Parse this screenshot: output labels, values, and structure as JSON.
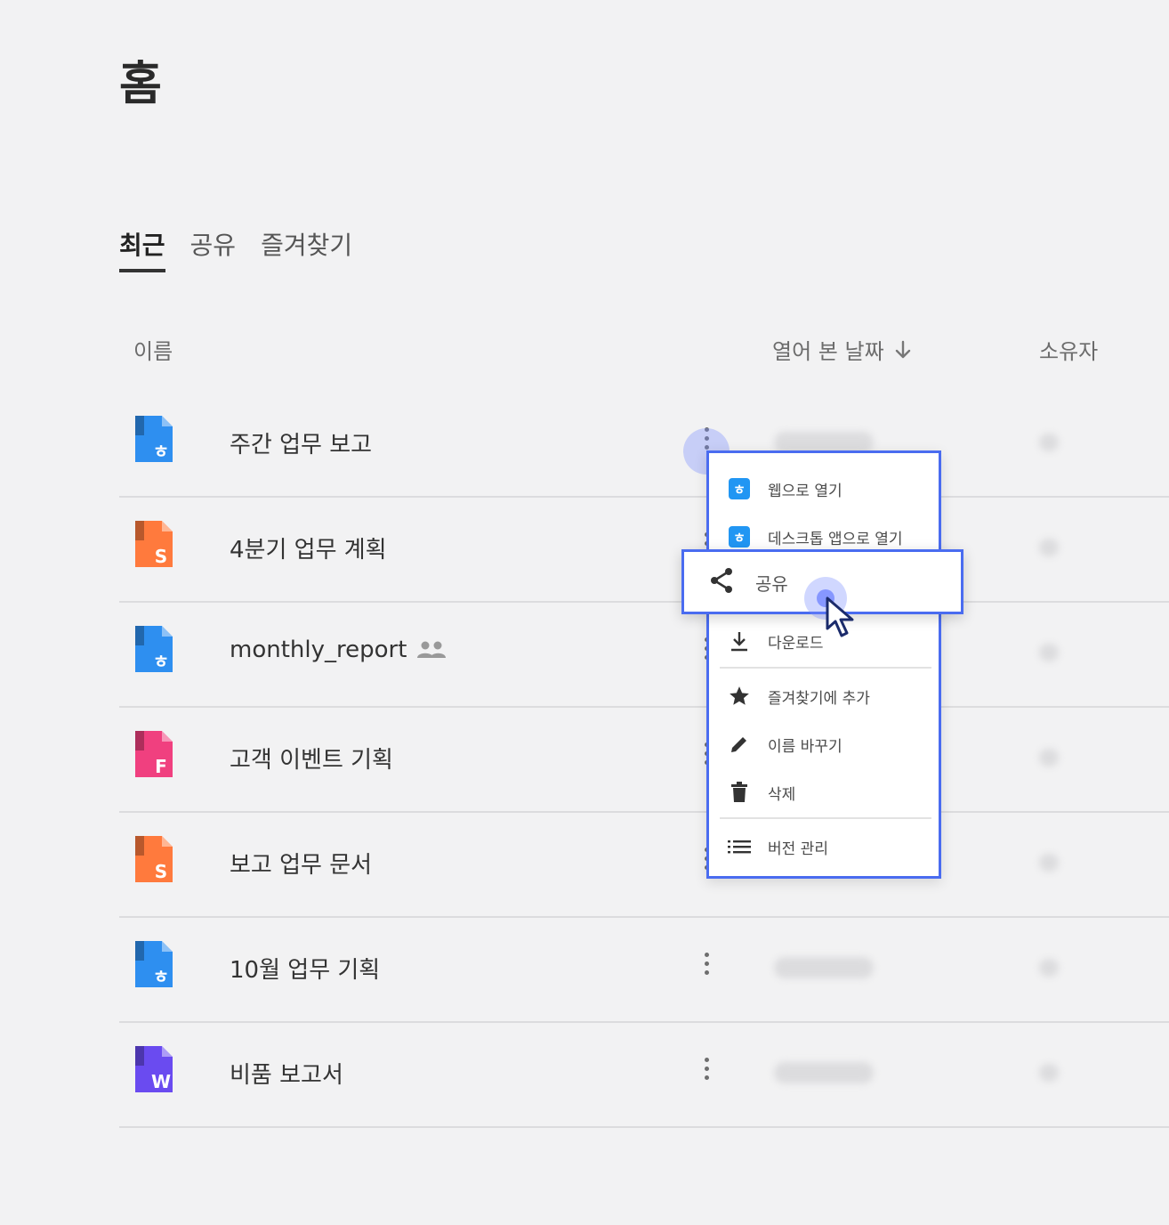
{
  "page": {
    "title": "홈"
  },
  "tabs": [
    {
      "label": "최근",
      "active": true
    },
    {
      "label": "공유",
      "active": false
    },
    {
      "label": "즐겨찾기",
      "active": false
    }
  ],
  "columns": {
    "name": "이름",
    "opened_date": "열어 본 날짜",
    "owner": "소유자"
  },
  "files": [
    {
      "name": "주간 업무 보고",
      "type": "doc",
      "icon_letter": "ㅎ",
      "color": "#2e8ff0",
      "shared": false
    },
    {
      "name": "4분기 업무 계획",
      "type": "sheet",
      "icon_letter": "S",
      "color": "#ff7a3d",
      "shared": false
    },
    {
      "name": "monthly_report",
      "type": "doc",
      "icon_letter": "ㅎ",
      "color": "#2e8ff0",
      "shared": true
    },
    {
      "name": "고객 이벤트 기획",
      "type": "form",
      "icon_letter": "F",
      "color": "#f0407f",
      "shared": false
    },
    {
      "name": "보고 업무 문서",
      "type": "sheet",
      "icon_letter": "S",
      "color": "#ff7a3d",
      "shared": false
    },
    {
      "name": "10월 업무 기획",
      "type": "doc",
      "icon_letter": "ㅎ",
      "color": "#2e8ff0",
      "shared": false
    },
    {
      "name": "비품 보고서",
      "type": "word",
      "icon_letter": "W",
      "color": "#6a4bf0",
      "shared": false
    }
  ],
  "context_menu": {
    "items": [
      {
        "label": "웹으로 열기",
        "icon": "web-app-icon"
      },
      {
        "label": "데스크톱 앱으로 열기",
        "icon": "desktop-app-icon"
      },
      {
        "label": "공유",
        "icon": "share-icon",
        "highlighted": true
      },
      {
        "label": "다운로드",
        "icon": "download-icon"
      },
      {
        "label": "즐겨찾기에 추가",
        "icon": "star-icon"
      },
      {
        "label": "이름 바꾸기",
        "icon": "pencil-icon"
      },
      {
        "label": "삭제",
        "icon": "trash-icon"
      },
      {
        "label": "버전 관리",
        "icon": "list-icon"
      }
    ]
  },
  "colors": {
    "accent": "#4a6cf0",
    "background": "#f2f2f3"
  }
}
